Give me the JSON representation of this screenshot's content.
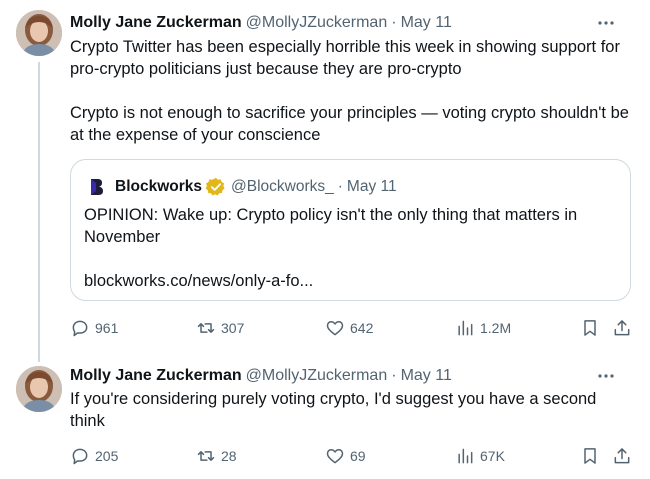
{
  "tweets": [
    {
      "author": {
        "name": "Molly Jane Zuckerman",
        "handle": "@MollyJZuckerman"
      },
      "date": "May 11",
      "paragraphs": [
        "Crypto Twitter has been especially horrible this week in showing support for pro-crypto politicians just because they are pro-crypto",
        "Crypto is not enough to sacrifice your principles — voting crypto shouldn't be at the expense of your conscience"
      ],
      "quote": {
        "name": "Blockworks",
        "handle": "@Blockworks_",
        "date": "May 11",
        "text": "OPINION: Wake up: Crypto policy isn't the only thing that matters in November",
        "link": "blockworks.co/news/only-a-fo..."
      },
      "stats": {
        "replies": "961",
        "retweets": "307",
        "likes": "642",
        "views": "1.2M"
      }
    },
    {
      "author": {
        "name": "Molly Jane Zuckerman",
        "handle": "@MollyJZuckerman"
      },
      "date": "May 11",
      "paragraphs": [
        "If you're considering purely voting crypto, I'd suggest you have a second think"
      ],
      "stats": {
        "replies": "205",
        "retweets": "28",
        "likes": "69",
        "views": "67K"
      }
    }
  ],
  "separator": "·",
  "icons": [
    "more-icon",
    "reply-icon",
    "retweet-icon",
    "like-icon",
    "views-icon",
    "bookmark-icon",
    "share-icon",
    "verified-icon",
    "blockworks-logo"
  ],
  "colors": {
    "text": "#0f1419",
    "secondary": "#536471",
    "border": "#cfd9de",
    "verified_gold": "#e2b719"
  }
}
